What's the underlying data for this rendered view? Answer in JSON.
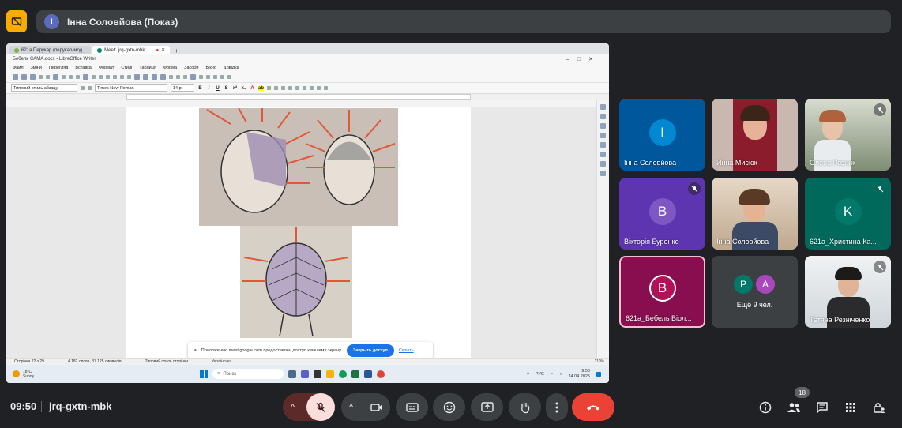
{
  "presenter": {
    "initial": "I",
    "label": "Інна Соловйова (Показ)"
  },
  "shared_screen": {
    "browser_tabs": [
      {
        "label": "621а Перукар (перукар-мод...",
        "color": "#7cb342"
      },
      {
        "label": "Meet: 'jrq-gxtn-mbk'",
        "color": "#00897b"
      }
    ],
    "window_title": "Бебель САМА.docx - LibreOffice Writer",
    "menu": [
      "Файл",
      "Зміни",
      "Перегляд",
      "Вставка",
      "Формат",
      "Стилі",
      "Таблиця",
      "Форма",
      "Засоби",
      "Вікно",
      "Довідка"
    ],
    "paragraph_style": "Типовий стиль абзацу",
    "font_name": "Times New Roman",
    "font_size": "14 pt",
    "status": {
      "page": "Сторінка 22 з 29",
      "words": "4 182 слова, 37 125 символів",
      "style": "Типовий стиль сторінки",
      "lang": "Українська",
      "zoom": "110%"
    },
    "share_notice": {
      "text": "Приложению meet.google.com предоставлен доступ к вашему экрану.",
      "stop_button": "Закрыть доступ",
      "hide_link": "Скрыть"
    },
    "taskbar": {
      "temp": "18°C",
      "weather": "Sunny",
      "search": "Поиск",
      "lang": "РУС",
      "time": "9:50",
      "date": "24.04.2025"
    }
  },
  "participants": [
    {
      "name": "Інна Соловйова",
      "initial": "I",
      "bg": "#01579b",
      "avatar_bg": "#0288d1",
      "type": "avatar",
      "muted": false
    },
    {
      "name": "Инна Мисюк",
      "type": "photo",
      "muted": false
    },
    {
      "name": "Олена Резник",
      "type": "photo",
      "muted": true
    },
    {
      "name": "Вікторія Буренко",
      "initial": "B",
      "bg": "#5e35b1",
      "avatar_bg": "#7e57c2",
      "type": "avatar",
      "muted": true
    },
    {
      "name": "Інна Соловйова",
      "type": "photo",
      "muted": false
    },
    {
      "name": "621а_Христина Ка...",
      "initial": "K",
      "bg": "#00695c",
      "avatar_bg": "#00796b",
      "type": "avatar",
      "muted": true
    },
    {
      "name": "621а_Бебель Віол...",
      "initial": "B",
      "bg": "#880e4f",
      "avatar_bg": "#ad1457",
      "type": "avatar",
      "muted": false,
      "active": true
    },
    {
      "name": "Ещё 9 чел.",
      "initials": [
        "P",
        "A"
      ],
      "type": "more"
    },
    {
      "name": "Тетяна Резніченко",
      "type": "photo",
      "muted": true
    }
  ],
  "bottom": {
    "time": "09:50",
    "meeting_code": "jrq-gxtn-mbk",
    "people_count": "18"
  },
  "colors": {
    "background": "#202124",
    "accent_yellow": "#f9ab00",
    "end_call": "#ea4335",
    "mic_off": "#f9dedc"
  }
}
